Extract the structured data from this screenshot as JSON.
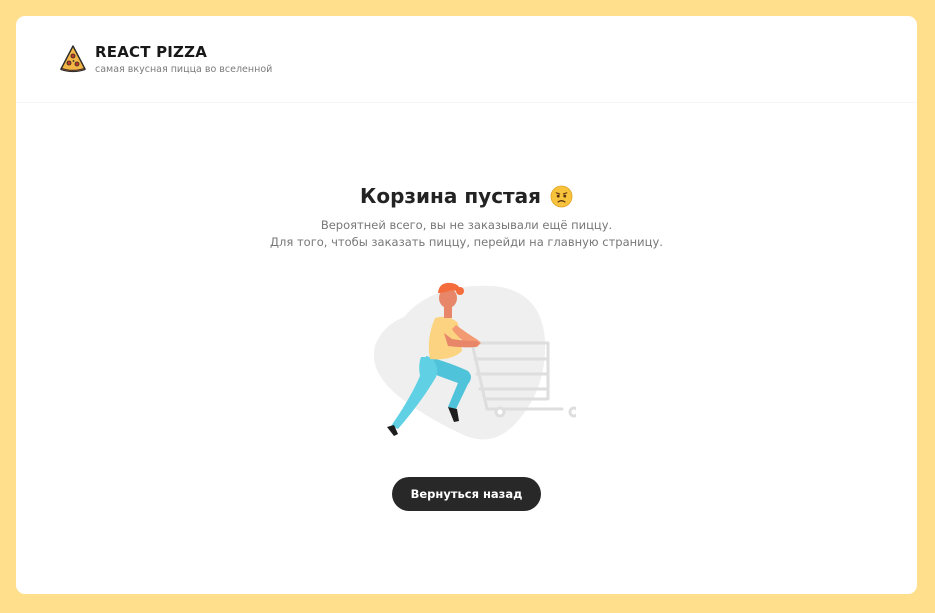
{
  "header": {
    "title": "REACT PIZZA",
    "subtitle": "самая вкусная пицца во вселенной",
    "logo_icon": "pizza-slice-icon"
  },
  "cart_empty": {
    "title": "Корзина пустая",
    "title_icon": "sad-face-emoji",
    "lines": [
      "Вероятней всего, вы не заказывали ещё пиццу.",
      "Для того, чтобы заказать пиццу, перейди на главную страницу."
    ],
    "illustration": "person-pushing-empty-cart",
    "back_button_label": "Вернуться назад"
  },
  "colors": {
    "page_background": "#ffdf8c",
    "card_background": "#ffffff",
    "button_background": "#282828",
    "button_text": "#ffffff",
    "title_text": "#181818",
    "muted_text": "#777777"
  }
}
